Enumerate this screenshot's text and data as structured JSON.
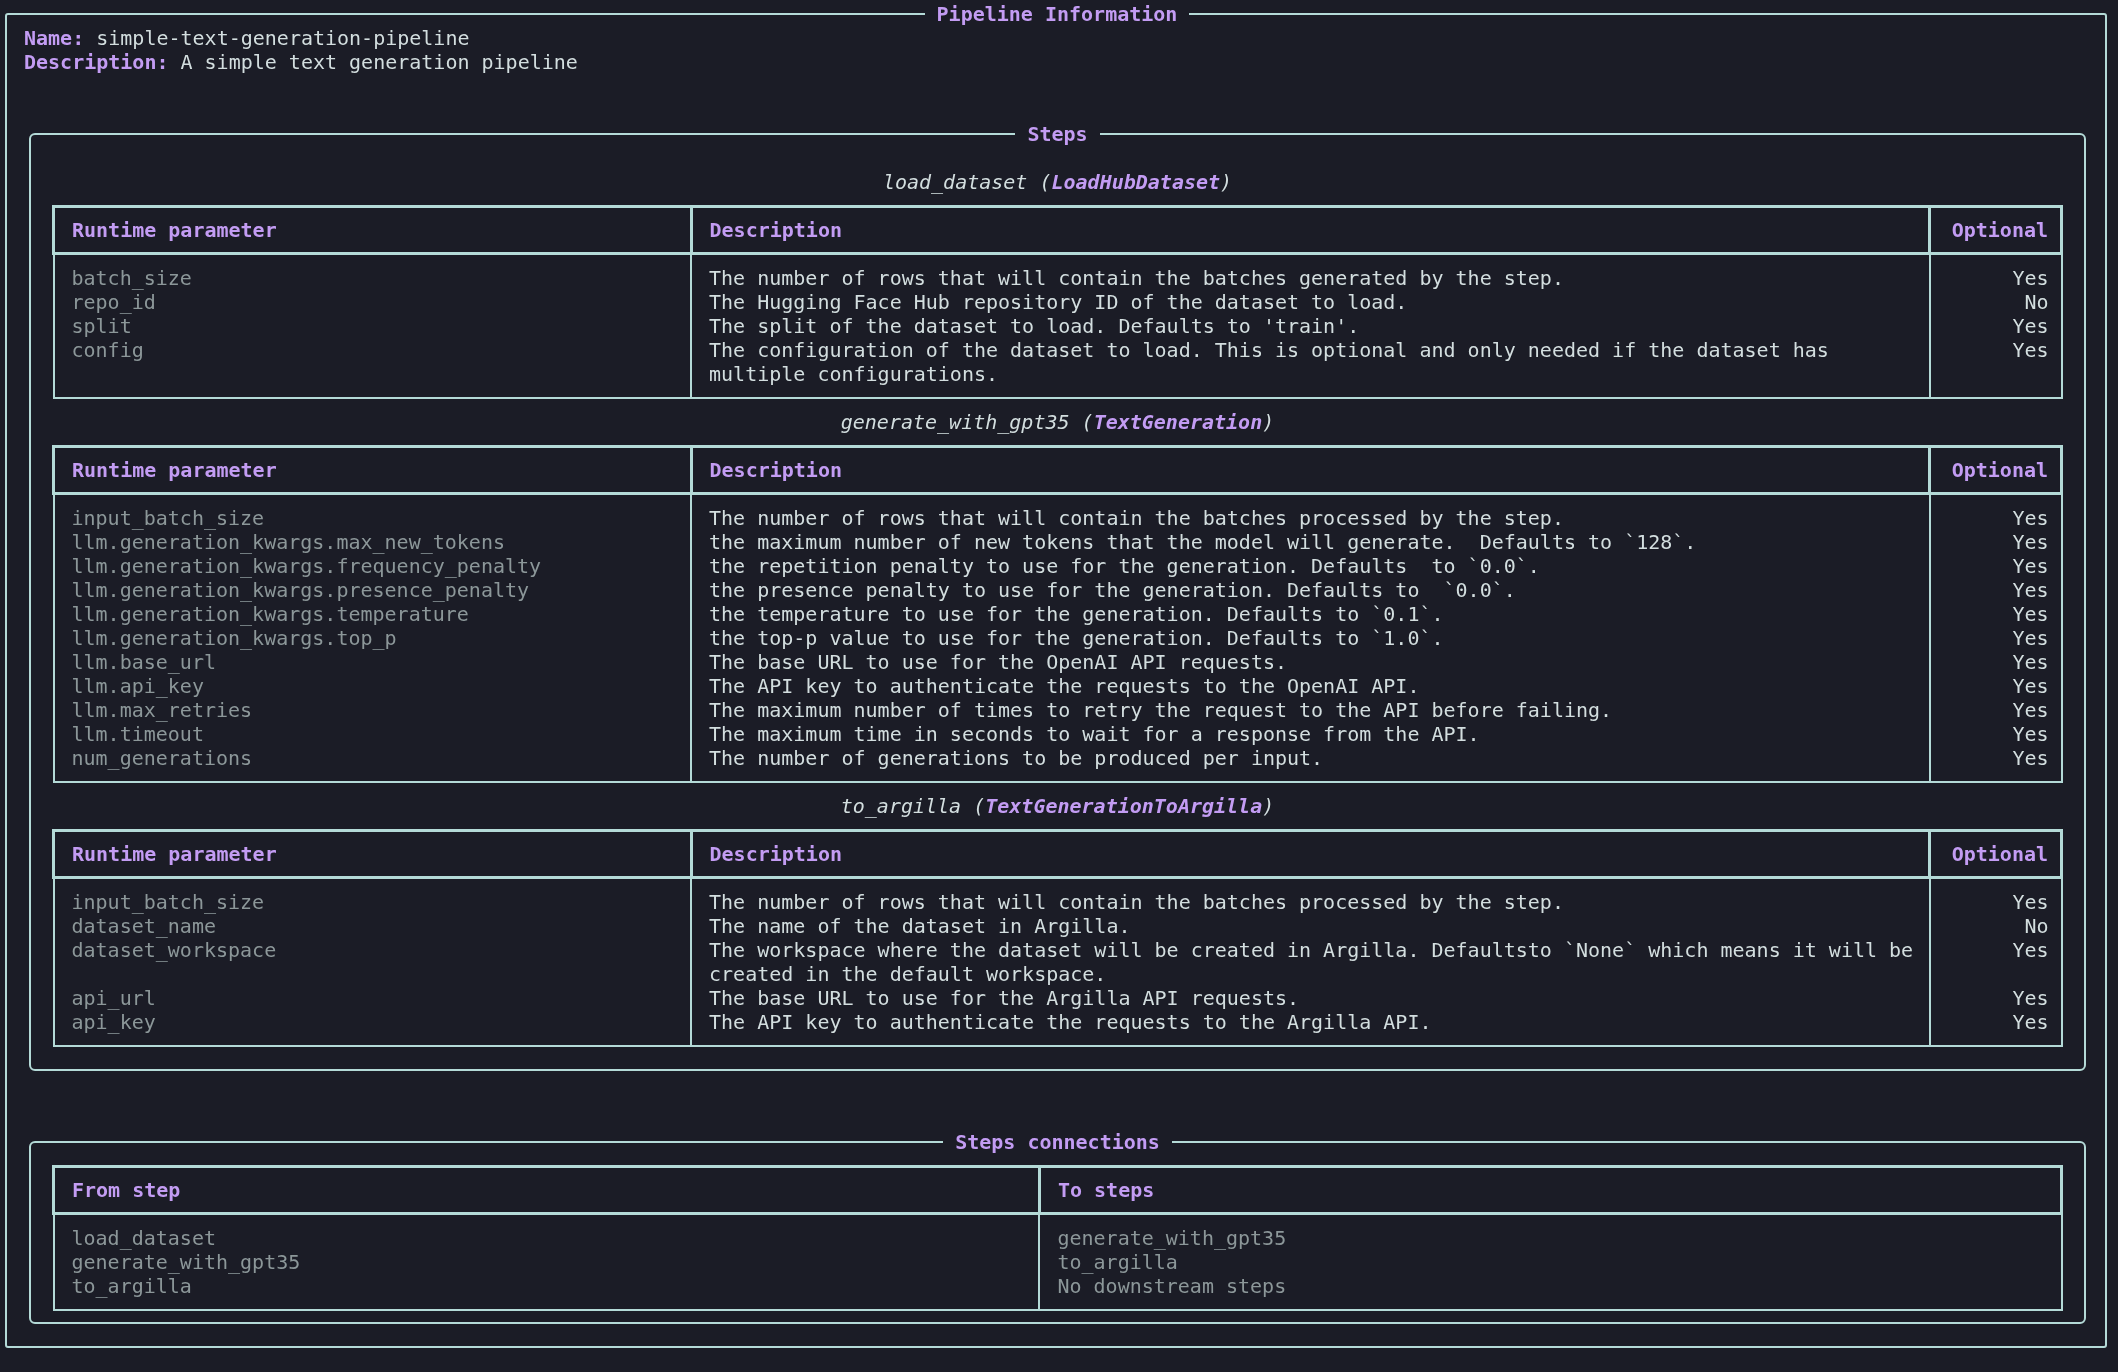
{
  "panel": {
    "title": "Pipeline Information"
  },
  "info": [
    {
      "label": "Name:",
      "value": "simple-text-generation-pipeline"
    },
    {
      "label": "Description:",
      "value": "A simple text generation pipeline"
    }
  ],
  "steps_panel": {
    "title": "Steps",
    "steps": [
      {
        "title": "load_dataset (**LoadHubDataset**)",
        "columns": [
          "Runtime parameter",
          "Description",
          "Optional"
        ],
        "rows": [
          {
            "parameter": "batch_size",
            "description": "The number of rows that will contain the batches generated by the step.",
            "optional": "Yes"
          },
          {
            "parameter": "repo_id",
            "description": "The Hugging Face Hub repository ID of the dataset to load.",
            "optional": "No"
          },
          {
            "parameter": "split",
            "description": "The split of the dataset to load. Defaults to 'train'.",
            "optional": "Yes"
          },
          {
            "parameter": "config",
            "description": "The configuration of the dataset to load. This is optional and only needed if the dataset has multiple configurations.",
            "optional": "Yes"
          }
        ]
      },
      {
        "title": "generate_with_gpt35 (**TextGeneration**)",
        "columns": [
          "Runtime parameter",
          "Description",
          "Optional"
        ],
        "rows": [
          {
            "parameter": "input_batch_size",
            "description": "The number of rows that will contain the batches processed by the step.",
            "optional": "Yes"
          },
          {
            "parameter": "llm.generation_kwargs.max_new_tokens",
            "description": "the maximum number of new tokens that the model will generate.  Defaults to `128`.",
            "optional": "Yes"
          },
          {
            "parameter": "llm.generation_kwargs.frequency_penalty",
            "description": "the repetition penalty to use for the generation. Defaults  to `0.0`.",
            "optional": "Yes"
          },
          {
            "parameter": "llm.generation_kwargs.presence_penalty",
            "description": "the presence penalty to use for the generation. Defaults to  `0.0`.",
            "optional": "Yes"
          },
          {
            "parameter": "llm.generation_kwargs.temperature",
            "description": "the temperature to use for the generation. Defaults to `0.1`.",
            "optional": "Yes"
          },
          {
            "parameter": "llm.generation_kwargs.top_p",
            "description": "the top-p value to use for the generation. Defaults to `1.0`.",
            "optional": "Yes"
          },
          {
            "parameter": "llm.base_url",
            "description": "The base URL to use for the OpenAI API requests.",
            "optional": "Yes"
          },
          {
            "parameter": "llm.api_key",
            "description": "The API key to authenticate the requests to the OpenAI API.",
            "optional": "Yes"
          },
          {
            "parameter": "llm.max_retries",
            "description": "The maximum number of times to retry the request to the API before failing.",
            "optional": "Yes"
          },
          {
            "parameter": "llm.timeout",
            "description": "The maximum time in seconds to wait for a response from the API.",
            "optional": "Yes"
          },
          {
            "parameter": "num_generations",
            "description": "The number of generations to be produced per input.",
            "optional": "Yes"
          }
        ]
      },
      {
        "title": "to_argilla (**TextGenerationToArgilla**)",
        "columns": [
          "Runtime parameter",
          "Description",
          "Optional"
        ],
        "rows": [
          {
            "parameter": "input_batch_size",
            "description": "The number of rows that will contain the batches processed by the step.",
            "optional": "Yes"
          },
          {
            "parameter": "dataset_name",
            "description": "The name of the dataset in Argilla.",
            "optional": "No"
          },
          {
            "parameter": "dataset_workspace",
            "description": "The workspace where the dataset will be created in Argilla. Defaultsto `None` which means it will be created in the default workspace.",
            "optional": "Yes"
          },
          {
            "parameter": "api_url",
            "description": "The base URL to use for the Argilla API requests.",
            "optional": "Yes"
          },
          {
            "parameter": "api_key",
            "description": "The API key to authenticate the requests to the Argilla API.",
            "optional": "Yes"
          }
        ]
      }
    ]
  },
  "connections_panel": {
    "title": "Steps connections",
    "columns": [
      "From step",
      "To steps"
    ],
    "rows": [
      {
        "from": "load_dataset",
        "to": "generate_with_gpt35"
      },
      {
        "from": "generate_with_gpt35",
        "to": "to_argilla"
      },
      {
        "from": "to_argilla",
        "to": "No downstream steps"
      }
    ]
  }
}
